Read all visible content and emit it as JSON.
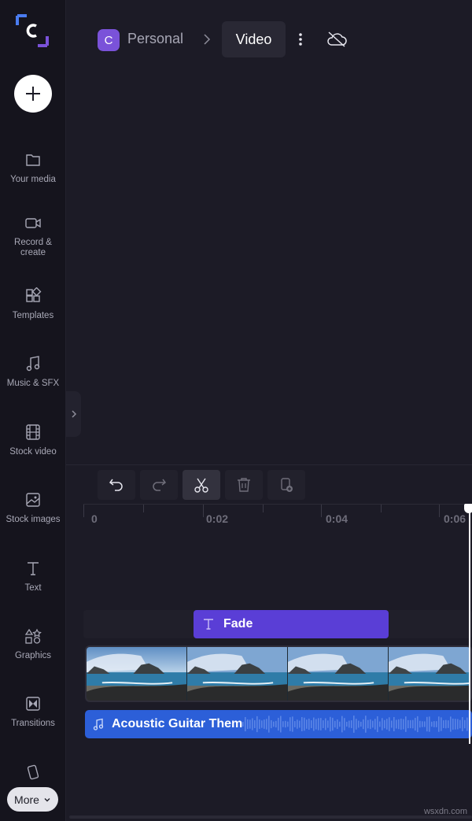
{
  "sidebar": {
    "items": [
      {
        "label": "Your media",
        "icon": "folder-icon"
      },
      {
        "label": "Record &\ncreate",
        "icon": "camera-icon"
      },
      {
        "label": "Templates",
        "icon": "templates-icon"
      },
      {
        "label": "Music & SFX",
        "icon": "music-icon"
      },
      {
        "label": "Stock video",
        "icon": "film-icon"
      },
      {
        "label": "Stock images",
        "icon": "image-icon"
      },
      {
        "label": "Text",
        "icon": "text-icon"
      },
      {
        "label": "Graphics",
        "icon": "shapes-icon"
      },
      {
        "label": "Transitions",
        "icon": "transitions-icon"
      }
    ],
    "more_label": "More"
  },
  "header": {
    "workspace_initial": "C",
    "workspace_name": "Personal",
    "project_name": "Video"
  },
  "timeline": {
    "ruler_labels": [
      "0",
      "0:02",
      "0:04",
      "0:06"
    ],
    "text_clip_label": "Fade",
    "audio_clip_label": "Acoustic Guitar Them"
  },
  "watermark": "wsxdn.com",
  "colors": {
    "accent_purple": "#5a3ed6",
    "audio_blue": "#2c5fd8",
    "workspace_badge": "#7a52d9"
  }
}
